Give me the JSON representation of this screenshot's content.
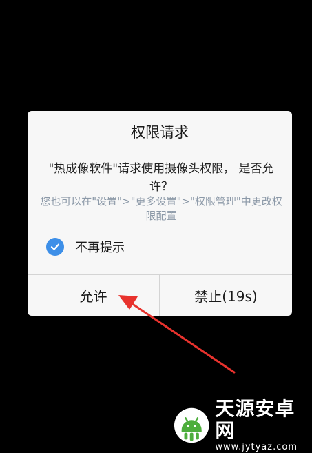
{
  "dialog": {
    "title": "权限请求",
    "message": "\"热成像软件\"请求使用摄像头权限， 是否允许？",
    "hint": "您也可以在\"设置\">\"更多设置\">\"权限管理\"中更改权限配置",
    "checkbox_label": "不再提示",
    "checkbox_checked": true,
    "allow_label": "允许",
    "deny_label": "禁止(19s)"
  },
  "watermark": {
    "title": "天源安卓网",
    "url": "www.jytyaz.com"
  },
  "colors": {
    "background": "#000000",
    "dialog_bg": "#f7f7f7",
    "accent": "#3d8fe8",
    "hint_text": "#8c99a8",
    "arrow": "#e8322d"
  }
}
